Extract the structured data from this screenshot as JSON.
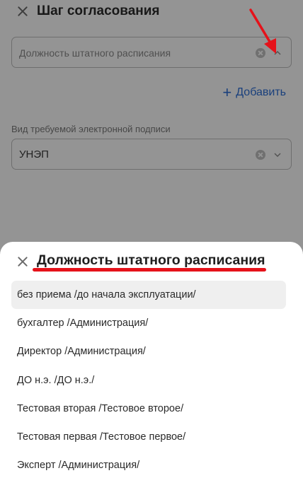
{
  "page": {
    "title": "Шаг согласования",
    "position_field": {
      "placeholder": "Должность штатного расписания"
    },
    "add_label": "Добавить",
    "signature_field": {
      "label": "Вид требуемой электронной подписи",
      "value": "УНЭП"
    }
  },
  "icons": {
    "close": "close-icon",
    "clear": "clear-icon",
    "chevron": "chevron-down-icon",
    "plus": "plus-icon"
  },
  "colors": {
    "accent": "#2d6fd6",
    "annotation": "#e5121a",
    "selected_row_bg": "#efefef"
  },
  "sheet": {
    "title": "Должность штатного расписания",
    "options": [
      "без приема /до начала эксплуатации/",
      "бухгалтер /Администрация/",
      "Директор /Администрация/",
      "ДО н.э. /ДО н.э./",
      "Тестовая вторая /Тестовое второе/",
      "Тестовая первая /Тестовое первое/",
      "Эксперт /Администрация/"
    ],
    "highlighted_index": 0
  }
}
